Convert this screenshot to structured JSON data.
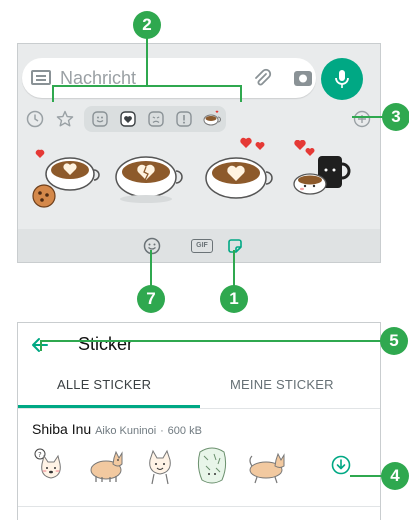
{
  "composer": {
    "placeholder": "Nachricht"
  },
  "callouts": {
    "c2": "2",
    "c3": "3",
    "c7": "7",
    "c1": "1",
    "c5": "5",
    "c4": "4"
  },
  "tray": {
    "gif_label": "GIF",
    "categories": [
      "recent",
      "favorites",
      "happy",
      "love",
      "sad",
      "exclamation",
      "coffee-pack"
    ]
  },
  "sticker_store": {
    "title": "Sticker",
    "tabs": [
      "ALLE STICKER",
      "MEINE STICKER"
    ],
    "pack": {
      "name": "Shiba Inu",
      "author": "Aiko Kuninoi",
      "separator": "·",
      "size": "600 kB"
    }
  },
  "colors": {
    "accent": "#00a884",
    "callout": "#2fa84f",
    "tray_bg": "#e9ebec"
  },
  "icons": [
    "keyboard-icon",
    "paperclip-icon",
    "camera-icon",
    "mic-icon",
    "clock-icon",
    "star-icon",
    "plus-circle-icon",
    "emoji-icon",
    "gif-icon",
    "sticker-icon",
    "back-arrow-icon",
    "download-icon"
  ]
}
